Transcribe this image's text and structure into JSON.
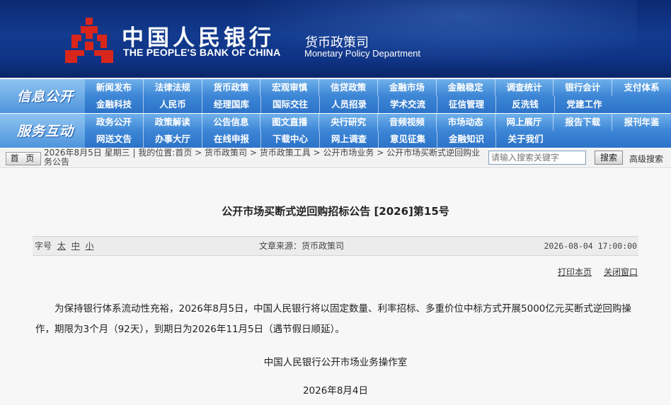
{
  "header": {
    "bank_cn": "中国人民银行",
    "bank_en": "THE PEOPLE'S BANK OF CHINA",
    "dept_cn": "货币政策司",
    "dept_en": "Monetary Policy Department",
    "logo_icon": "pboc-logo-icon",
    "colors": {
      "banner": "#123a8e",
      "logo_red": "#d9261c",
      "nav": "#3d86d6"
    }
  },
  "nav1": {
    "title": "信息公开",
    "rows": [
      [
        "新闻发布",
        "法律法规",
        "货币政策",
        "宏观审慎",
        "信贷政策",
        "金融市场",
        "金融稳定",
        "调查统计",
        "银行会计",
        "支付体系"
      ],
      [
        "金融科技",
        "人民币",
        "经理国库",
        "国际交往",
        "人员招录",
        "学术交流",
        "征信管理",
        "反洗钱",
        "党建工作"
      ]
    ]
  },
  "nav2": {
    "title": "服务互动",
    "rows": [
      [
        "政务公开",
        "政策解读",
        "公告信息",
        "图文直播",
        "央行研究",
        "音频视频",
        "市场动态",
        "网上展厅",
        "报告下载",
        "报刊年鉴"
      ],
      [
        "网送文告",
        "办事大厅",
        "在线申报",
        "下载中心",
        "网上调查",
        "意见征集",
        "金融知识",
        "关于我们"
      ]
    ]
  },
  "breadcrumb": {
    "home": "首 页",
    "text": "2026年8月5日 星期三 | 我的位置:首页 > 货币政策司 > 货币政策工具 > 公开市场业务 > 公开市场买断式逆回购业务公告",
    "search_placeholder": "请输入搜索关键字",
    "search_button": "搜索",
    "advanced_search": "高级搜索"
  },
  "article": {
    "title": "公开市场买断式逆回购招标公告 [2026]第15号",
    "font_size_label": "字号",
    "font_sizes": [
      "太",
      "中",
      "小"
    ],
    "source": "文章来源：货币政策司",
    "date": "2026-08-04 17:00:00",
    "print": "打印本页",
    "close": "关闭窗口",
    "body": "为保持银行体系流动性充裕，2026年8月5日，中国人民银行将以固定数量、利率招标、多重价位中标方式开展5000亿元买断式逆回购操作，期限为3个月（92天），到期日为2026年11月5日（遇节假日顺延）。",
    "signer": "中国人民银行公开市场业务操作室",
    "sign_date": "2026年8月4日"
  }
}
